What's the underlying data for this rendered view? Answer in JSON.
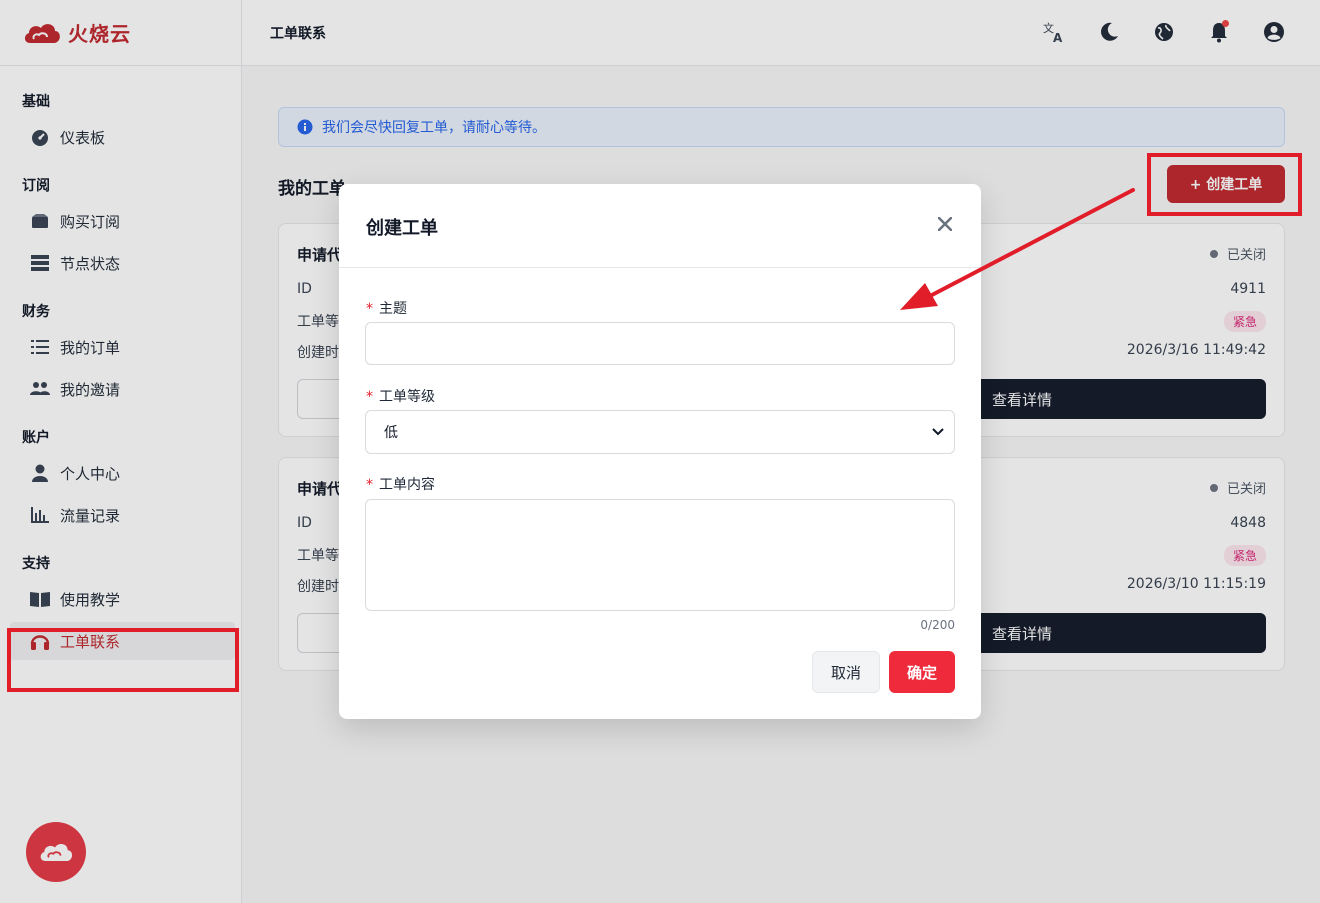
{
  "brand": {
    "name": "火烧云",
    "color": "#c0272d"
  },
  "sidebar": {
    "sections": [
      {
        "title": "基础",
        "items": [
          {
            "label": "仪表板",
            "icon": "gauge-icon"
          }
        ]
      },
      {
        "title": "订阅",
        "items": [
          {
            "label": "购买订阅",
            "icon": "box-icon"
          },
          {
            "label": "节点状态",
            "icon": "server-icon"
          }
        ]
      },
      {
        "title": "财务",
        "items": [
          {
            "label": "我的订单",
            "icon": "list-icon"
          },
          {
            "label": "我的邀请",
            "icon": "users-icon"
          }
        ]
      },
      {
        "title": "账户",
        "items": [
          {
            "label": "个人中心",
            "icon": "user-icon"
          },
          {
            "label": "流量记录",
            "icon": "bar-chart-icon"
          }
        ]
      },
      {
        "title": "支持",
        "items": [
          {
            "label": "使用教学",
            "icon": "book-icon"
          },
          {
            "label": "工单联系",
            "icon": "headphones-icon",
            "active": true
          }
        ]
      }
    ]
  },
  "header": {
    "title": "工单联系"
  },
  "main": {
    "alert": "我们会尽快回复工单，请耐心等待。",
    "section_title": "我的工单",
    "create_button": "+ 创建工单",
    "tickets": [
      {
        "title": "申请代",
        "status": "已关闭",
        "id_label": "ID",
        "id": "4911",
        "level_label": "工单等",
        "level": "紧急",
        "created_label": "创建时",
        "created": "2026/3/16 11:49:42",
        "detail_button": "查看详情"
      },
      {
        "title": "申请代",
        "status": "已关闭",
        "id_label": "ID",
        "id": "4848",
        "level_label": "工单等",
        "level": "紧急",
        "created_label": "创建时",
        "created": "2026/3/10 11:15:19",
        "detail_button": "查看详情"
      }
    ]
  },
  "modal": {
    "title": "创建工单",
    "required_mark": "*",
    "subject_label": "主题",
    "subject_value": "",
    "level_label": "工单等级",
    "level_value": "低",
    "content_label": "工单内容",
    "content_value": "",
    "counter": "0/200",
    "cancel_button": "取消",
    "confirm_button": "确定"
  },
  "colors": {
    "accent": "#c0272d",
    "confirm": "#ee2a3b",
    "highlight": "#e11d2a",
    "dark_button": "#131a2a"
  }
}
